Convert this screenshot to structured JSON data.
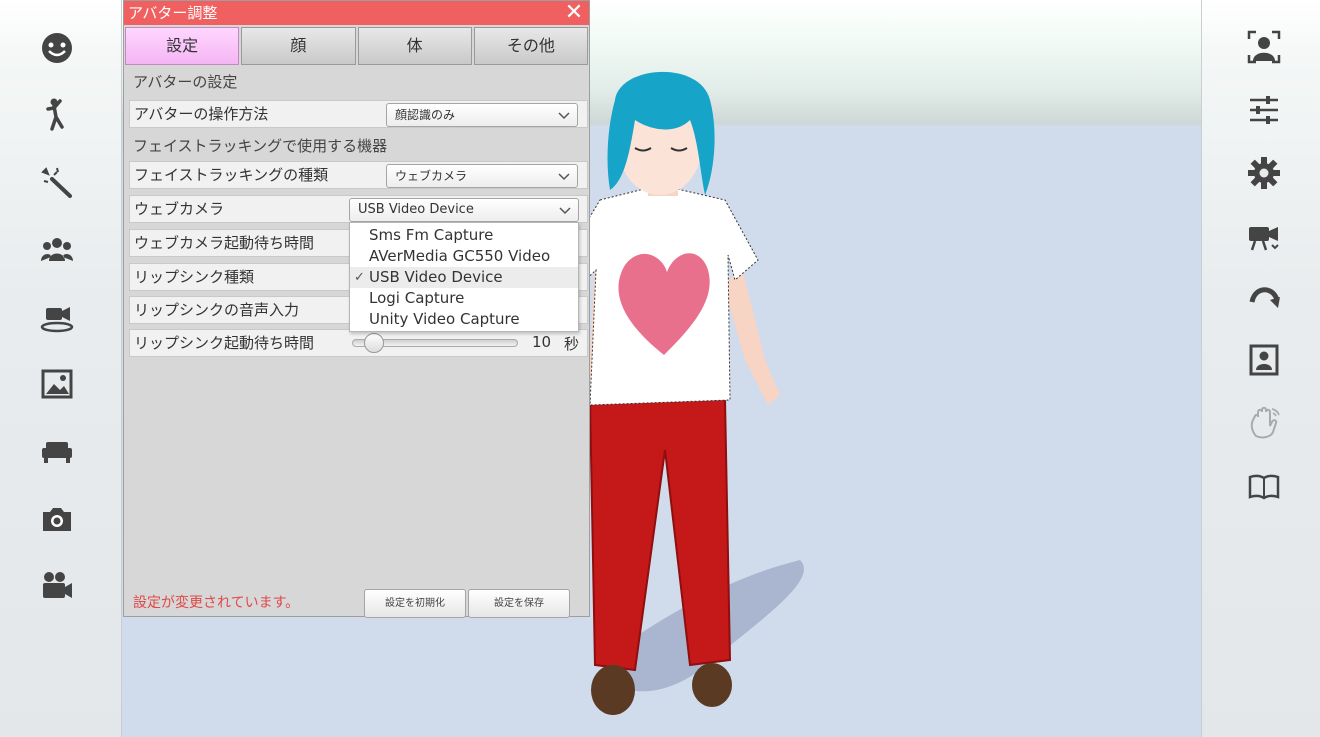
{
  "panel": {
    "title": "アバター調整",
    "tabs": [
      "設定",
      "顔",
      "体",
      "その他"
    ],
    "active_tab": "設定",
    "sections": {
      "avatar_settings": "アバターの設定",
      "face_tracking_device": "フェイストラッキングで使用する機器"
    },
    "rows": {
      "control_method": {
        "label": "アバターの操作方法",
        "value": "顔認識のみ"
      },
      "tracking_type": {
        "label": "フェイストラッキングの種類",
        "value": "ウェブカメラ"
      },
      "webcam": {
        "label": "ウェブカメラ",
        "value": "USB Video Device"
      },
      "webcam_wait": {
        "label": "ウェブカメラ起動待ち時間"
      },
      "lipsync_type": {
        "label": "リップシンク種類"
      },
      "lipsync_input": {
        "label": "リップシンクの音声入力"
      },
      "lipsync_wait": {
        "label": "リップシンク起動待ち時間",
        "value": "10",
        "unit": "秒",
        "slider_fraction": 0.13
      }
    },
    "webcam_options": [
      "Sms Fm Capture",
      "AVerMedia GC550 Video",
      "USB Video Device",
      "Logi Capture",
      "Unity Video Capture"
    ],
    "webcam_selected": "USB Video Device",
    "footer": {
      "message": "設定が変更されています。",
      "reset_label": "設定を初期化",
      "save_label": "設定を保存"
    }
  },
  "colors": {
    "title_bar": "#f06060",
    "active_tab": "#f6c2f6",
    "warning_text": "#e04848"
  },
  "left_toolbar_icons": [
    "smile-face-icon",
    "dance-pose-icon",
    "magic-wand-icon",
    "group-people-icon",
    "camera-stand-icon",
    "image-icon",
    "sofa-icon",
    "camera-icon",
    "movie-camera-icon"
  ],
  "right_toolbar_icons": [
    "face-tracking-icon",
    "sliders-icon",
    "gear-icon",
    "video-camera-icon",
    "undo-arrow-icon",
    "portrait-frame-icon",
    "waving-hand-icon",
    "book-icon"
  ]
}
